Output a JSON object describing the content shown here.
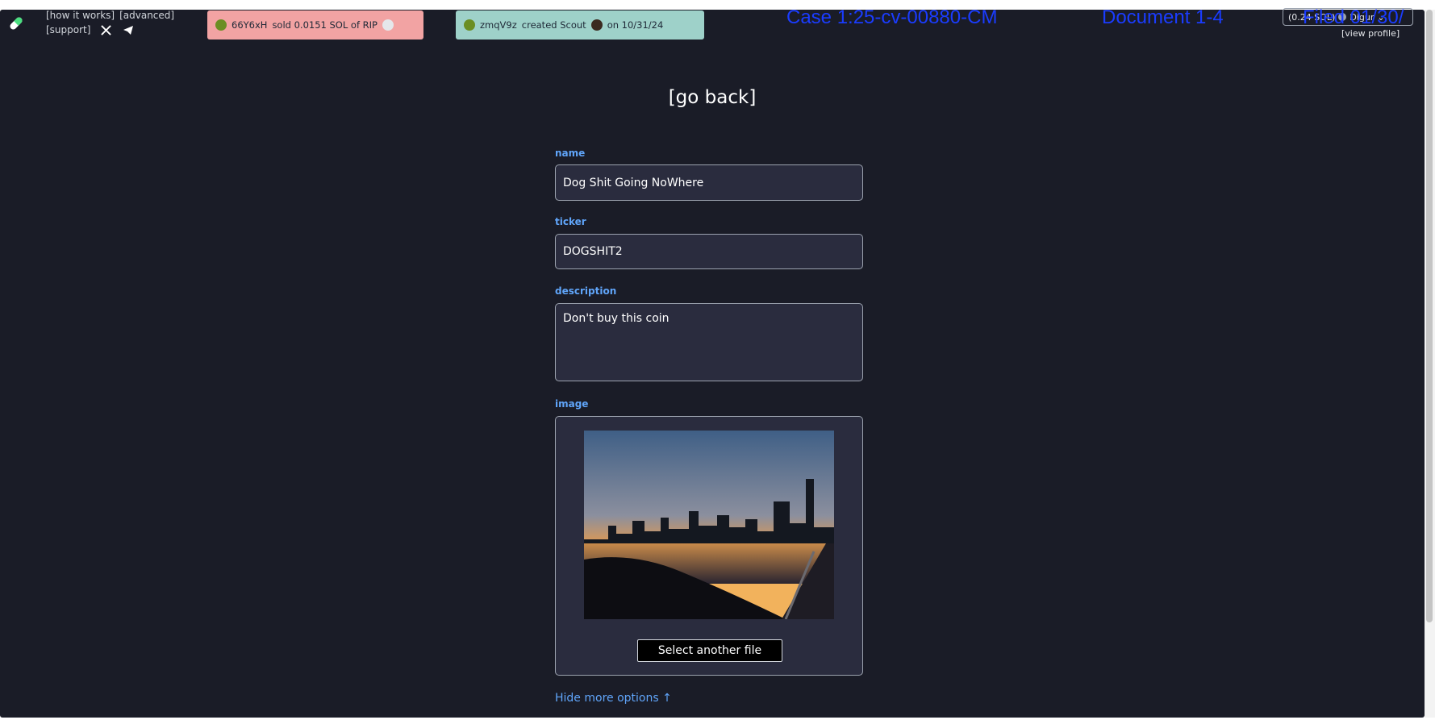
{
  "header": {
    "links_row1": [
      "[how it works]",
      "[advanced]"
    ],
    "links_row2": [
      "[support]"
    ],
    "social_icons": [
      "x-icon",
      "telegram-icon"
    ],
    "ticker_sell": {
      "user": "66Y6xH",
      "text": "sold 0.0151 SOL of RIP",
      "color": "#f2a3a3"
    },
    "ticker_create": {
      "user": "zmqV9z",
      "text": "created Scout",
      "date": "on 10/31/24",
      "color": "#9ed1c9"
    },
    "wallet": {
      "balance": "(0.24 SOL)",
      "name": "Digur"
    },
    "view_profile": "[view profile]"
  },
  "watermark": {
    "case": "Case 1:25-cv-00880-CM",
    "document": "Document 1-4",
    "filed": "Filed 01/30/"
  },
  "form": {
    "go_back": "[go back]",
    "name_label": "name",
    "name_value": "Dog Shit Going NoWhere",
    "ticker_label": "ticker",
    "ticker_value": "DOGSHIT2",
    "description_label": "description",
    "description_value": "Don't buy this coin",
    "image_label": "image",
    "select_file": "Select another file",
    "hide_options": "Hide more options ↑"
  },
  "colors": {
    "background": "#1a1c27",
    "field_bg": "#2a2c3e",
    "label": "#60a5fa",
    "watermark": "#1a3cff"
  }
}
